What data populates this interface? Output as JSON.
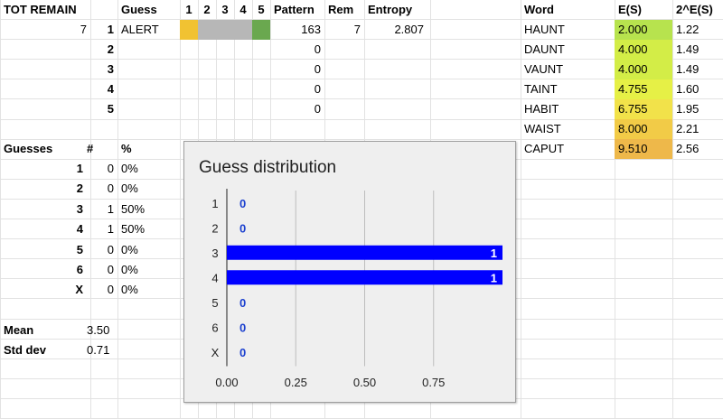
{
  "sheet": {
    "headers": {
      "tot_remain": "TOT REMAIN",
      "guess": "Guess",
      "cols": [
        "1",
        "2",
        "3",
        "4",
        "5"
      ],
      "pattern": "Pattern",
      "rem": "Rem",
      "entropy": "Entropy",
      "word": "Word",
      "es": "E(S)",
      "pow": "2^E(S)"
    },
    "tot_remain_value": "7",
    "guess_rows": [
      {
        "num": "1",
        "word": "ALERT",
        "tiles": [
          "#f1c232",
          "#b7b7b7",
          "#b7b7b7",
          "#b7b7b7",
          "#6aa84f"
        ],
        "pattern": "163",
        "rem": "7",
        "entropy": "2.807"
      },
      {
        "num": "2",
        "word": "",
        "tiles": [],
        "pattern": "0",
        "rem": "",
        "entropy": ""
      },
      {
        "num": "3",
        "word": "",
        "tiles": [],
        "pattern": "0",
        "rem": "",
        "entropy": ""
      },
      {
        "num": "4",
        "word": "",
        "tiles": [],
        "pattern": "0",
        "rem": "",
        "entropy": ""
      },
      {
        "num": "5",
        "word": "",
        "tiles": [],
        "pattern": "0",
        "rem": "",
        "entropy": ""
      }
    ],
    "candidates": [
      {
        "word": "HAUNT",
        "es": "2.000",
        "pow": "1.22",
        "color": "#b7e34e"
      },
      {
        "word": "DAUNT",
        "es": "4.000",
        "pow": "1.49",
        "color": "#d3ed47"
      },
      {
        "word": "VAUNT",
        "es": "4.000",
        "pow": "1.49",
        "color": "#d3ed47"
      },
      {
        "word": "TAINT",
        "es": "4.755",
        "pow": "1.60",
        "color": "#e6f046"
      },
      {
        "word": "HABIT",
        "es": "6.755",
        "pow": "1.95",
        "color": "#f2e24a"
      },
      {
        "word": "WAIST",
        "es": "8.000",
        "pow": "2.21",
        "color": "#f2cb47"
      },
      {
        "word": "CAPUT",
        "es": "9.510",
        "pow": "2.56",
        "color": "#eeb84a"
      }
    ],
    "stats": {
      "headers": {
        "guesses": "Guesses",
        "count": "#",
        "pct": "%"
      },
      "rows": [
        {
          "label": "1",
          "count": "0",
          "pct": "0%"
        },
        {
          "label": "2",
          "count": "0",
          "pct": "0%"
        },
        {
          "label": "3",
          "count": "1",
          "pct": "50%"
        },
        {
          "label": "4",
          "count": "1",
          "pct": "50%"
        },
        {
          "label": "5",
          "count": "0",
          "pct": "0%"
        },
        {
          "label": "6",
          "count": "0",
          "pct": "0%"
        },
        {
          "label": "X",
          "count": "0",
          "pct": "0%"
        }
      ],
      "mean_label": "Mean",
      "mean": "3.50",
      "std_label": "Std dev",
      "std": "0.71"
    }
  },
  "chart_data": {
    "type": "bar",
    "orientation": "horizontal",
    "title": "Guess distribution",
    "categories": [
      "1",
      "2",
      "3",
      "4",
      "5",
      "6",
      "X"
    ],
    "values": [
      0,
      0,
      1,
      1,
      0,
      0,
      0
    ],
    "data_labels": [
      "0",
      "0",
      "1",
      "1",
      "0",
      "0",
      "0"
    ],
    "xlim": [
      0,
      1
    ],
    "x_ticks": [
      "0.00",
      "0.25",
      "0.50",
      "0.75"
    ],
    "x_tick_values": [
      0,
      0.25,
      0.5,
      0.75
    ],
    "bar_color": "#0000ff",
    "grid": true,
    "legend": "none"
  },
  "colors": {
    "gridline": "#e2e2e2",
    "label_zero": "#1a3fcf"
  }
}
